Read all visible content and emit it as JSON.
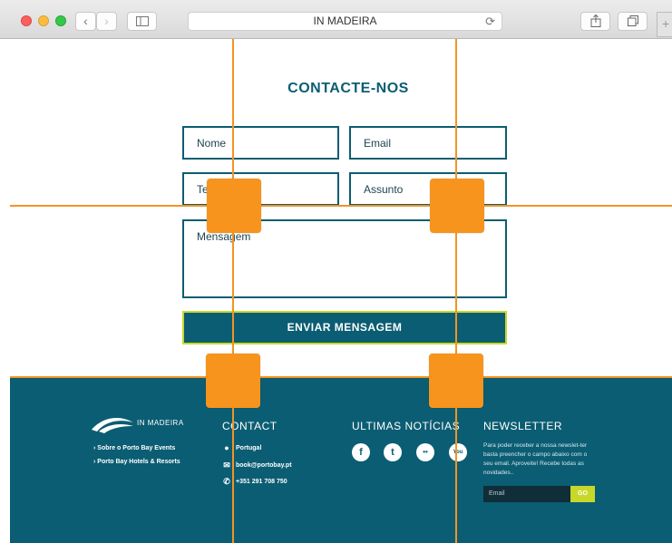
{
  "browser": {
    "url_title": "IN MADEIRA",
    "reload_icon": "⟳",
    "back_icon": "‹",
    "forward_icon": "›"
  },
  "form": {
    "title": "CONTACTE-NOS",
    "name_placeholder": "Nome",
    "email_placeholder": "Email",
    "phone_placeholder": "Te",
    "subject_placeholder": "Assunto",
    "message_placeholder": "Mensagem",
    "submit_label": "ENVIAR MENSAGEM"
  },
  "footer": {
    "brand": "IN MADEIRA",
    "links": [
      "› Sobre o Porto Bay Events",
      "› Porto Bay Hotels & Resorts"
    ],
    "contact": {
      "heading": "CONTACT",
      "location": "Portugal",
      "email": "book@portobay.pt",
      "phone": "+351 291 708 750"
    },
    "news": {
      "heading": "ULTIMAS NOTÍCIAS",
      "social": [
        "f",
        "t",
        "••",
        "You"
      ]
    },
    "newsletter": {
      "heading": "NEWSLETTER",
      "text": "Para poder receber a nossa newslet-ter basta preencher o campo abaixo com o seu email. Aproveite! Recebe todas as novidades..",
      "email_placeholder": "Email",
      "submit_label": "GO"
    }
  },
  "colors": {
    "brand_teal": "#0b5d73",
    "accent_lime": "#c7d82b",
    "guide_orange": "#f39325"
  }
}
